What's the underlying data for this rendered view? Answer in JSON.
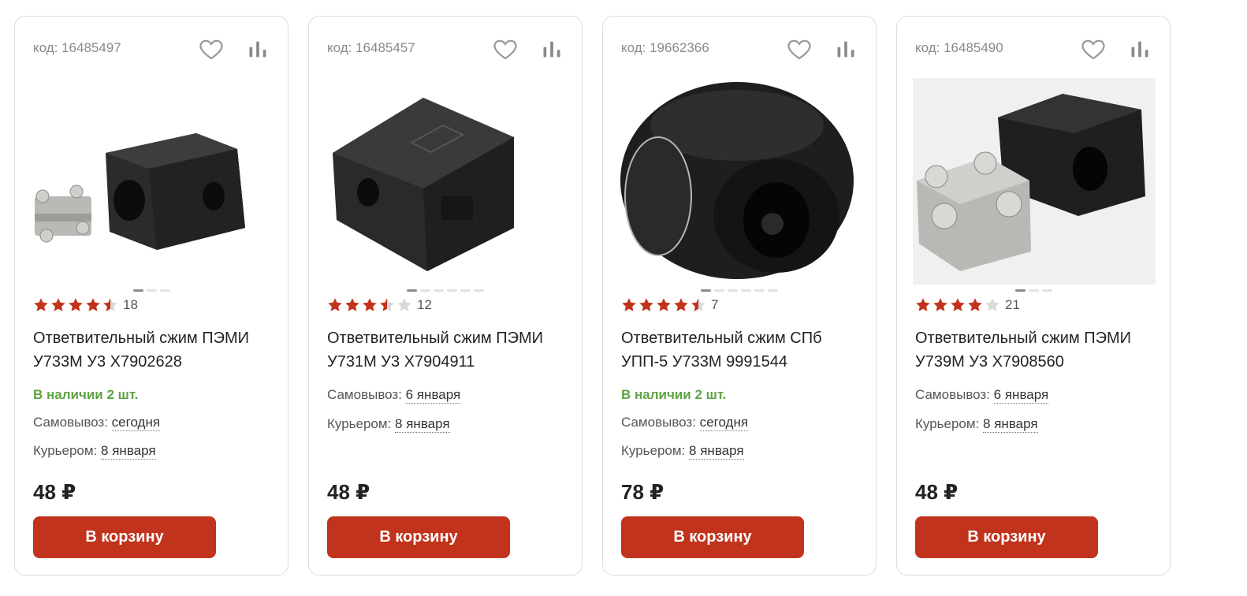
{
  "colors": {
    "accent": "#c1331c",
    "star": "#c1331c",
    "star_empty": "#d9d9d9",
    "in_stock": "#5fa343"
  },
  "icons": {
    "favorite": "heart-icon",
    "compare": "bar-chart-icon",
    "rating": "star-icon"
  },
  "products": [
    {
      "code": "код: 16485497",
      "rating": 4.5,
      "reviews": "18",
      "title": "Ответвительный сжим ПЭМИ У733М У3 Х7902628",
      "image": "clamp-with-plate",
      "dots": 3,
      "active_dot": 0,
      "availability": "В наличии 2 шт.",
      "pickup_label": "Самовывоз:",
      "pickup_value": "сегодня",
      "courier_label": "Курьером:",
      "courier_value": "8 января",
      "price": "48 ₽",
      "button": "В корзину"
    },
    {
      "code": "код: 16485457",
      "rating": 3.5,
      "reviews": "12",
      "title": "Ответвительный сжим ПЭМИ У731М У3 Х7904911",
      "image": "clamp-block",
      "dots": 6,
      "active_dot": 0,
      "availability": "",
      "pickup_label": "Самовывоз:",
      "pickup_value": "6 января",
      "courier_label": "Курьером:",
      "courier_value": "8 января",
      "price": "48 ₽",
      "button": "В корзину"
    },
    {
      "code": "код: 19662366",
      "rating": 4.5,
      "reviews": "7",
      "title": "Ответвительный сжим СПб УПП-5 У733М 9991544",
      "image": "clamp-round",
      "dots": 6,
      "active_dot": 0,
      "availability": "В наличии 2 шт.",
      "pickup_label": "Самовывоз:",
      "pickup_value": "сегодня",
      "courier_label": "Курьером:",
      "courier_value": "8 января",
      "price": "78 ₽",
      "button": "В корзину"
    },
    {
      "code": "код: 16485490",
      "rating": 4,
      "reviews": "21",
      "title": "Ответвительный сжим ПЭМИ У739М У3 Х7908560",
      "image": "clamp-with-plate-large",
      "dots": 3,
      "active_dot": 0,
      "availability": "",
      "pickup_label": "Самовывоз:",
      "pickup_value": "6 января",
      "courier_label": "Курьером:",
      "courier_value": "8 января",
      "price": "48 ₽",
      "button": "В корзину"
    }
  ]
}
